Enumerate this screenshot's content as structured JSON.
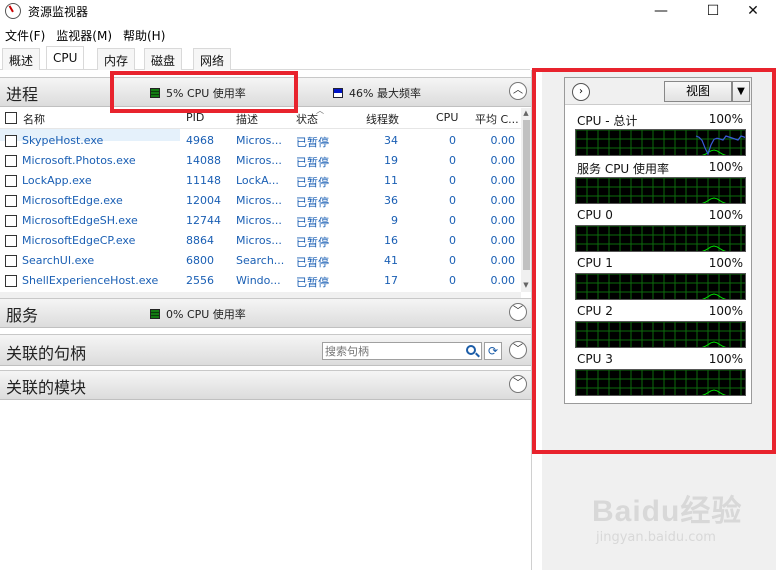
{
  "window": {
    "title": "资源监视器",
    "minimize": "—",
    "maximize": "☐",
    "close": "✕"
  },
  "menu": [
    "文件(F)",
    "监视器(M)",
    "帮助(H)"
  ],
  "tabs": [
    "概述",
    "CPU",
    "内存",
    "磁盘",
    "网络"
  ],
  "active_tab": "CPU",
  "processes": {
    "title": "进程",
    "cpu_usage": "5% CPU 使用率",
    "max_freq": "46% 最大频率",
    "columns": [
      "名称",
      "PID",
      "描述",
      "状态",
      "线程数",
      "CPU",
      "平均 C..."
    ],
    "rows": [
      {
        "name": "SkypeHost.exe",
        "pid": "4968",
        "desc": "Micros...",
        "status": "已暂停",
        "threads": "34",
        "cpu": "0",
        "avg": "0.00"
      },
      {
        "name": "Microsoft.Photos.exe",
        "pid": "14088",
        "desc": "Micros...",
        "status": "已暂停",
        "threads": "19",
        "cpu": "0",
        "avg": "0.00"
      },
      {
        "name": "LockApp.exe",
        "pid": "11148",
        "desc": "LockA...",
        "status": "已暂停",
        "threads": "11",
        "cpu": "0",
        "avg": "0.00"
      },
      {
        "name": "MicrosoftEdge.exe",
        "pid": "12004",
        "desc": "Micros...",
        "status": "已暂停",
        "threads": "36",
        "cpu": "0",
        "avg": "0.00"
      },
      {
        "name": "MicrosoftEdgeSH.exe",
        "pid": "12744",
        "desc": "Micros...",
        "status": "已暂停",
        "threads": "9",
        "cpu": "0",
        "avg": "0.00"
      },
      {
        "name": "MicrosoftEdgeCP.exe",
        "pid": "8864",
        "desc": "Micros...",
        "status": "已暂停",
        "threads": "16",
        "cpu": "0",
        "avg": "0.00"
      },
      {
        "name": "SearchUI.exe",
        "pid": "6800",
        "desc": "Search...",
        "status": "已暂停",
        "threads": "41",
        "cpu": "0",
        "avg": "0.00"
      },
      {
        "name": "ShellExperienceHost.exe",
        "pid": "2556",
        "desc": "Windo...",
        "status": "已暂停",
        "threads": "17",
        "cpu": "0",
        "avg": "0.00"
      }
    ]
  },
  "services": {
    "title": "服务",
    "cpu_usage": "0% CPU 使用率"
  },
  "handles": {
    "title": "关联的句柄",
    "search_placeholder": "搜索句柄"
  },
  "modules": {
    "title": "关联的模块"
  },
  "graphs": {
    "view_label": "视图",
    "items": [
      {
        "label": "CPU - 总计",
        "max": "100%"
      },
      {
        "label": "服务 CPU 使用率",
        "max": "100%"
      },
      {
        "label": "CPU 0",
        "max": "100%"
      },
      {
        "label": "CPU 1",
        "max": "100%"
      },
      {
        "label": "CPU 2",
        "max": "100%"
      },
      {
        "label": "CPU 3",
        "max": "100%"
      }
    ]
  },
  "watermark": {
    "logo": "Baidu经验",
    "url": "jingyan.baidu.com"
  },
  "colors": {
    "link": "#1a5fb4",
    "highlight": "#e8232d",
    "graph_bg": "#000000",
    "graph_grid": "#0d6b0d",
    "graph_line": "#00e000",
    "graph_max_line": "#3a5bd9"
  }
}
